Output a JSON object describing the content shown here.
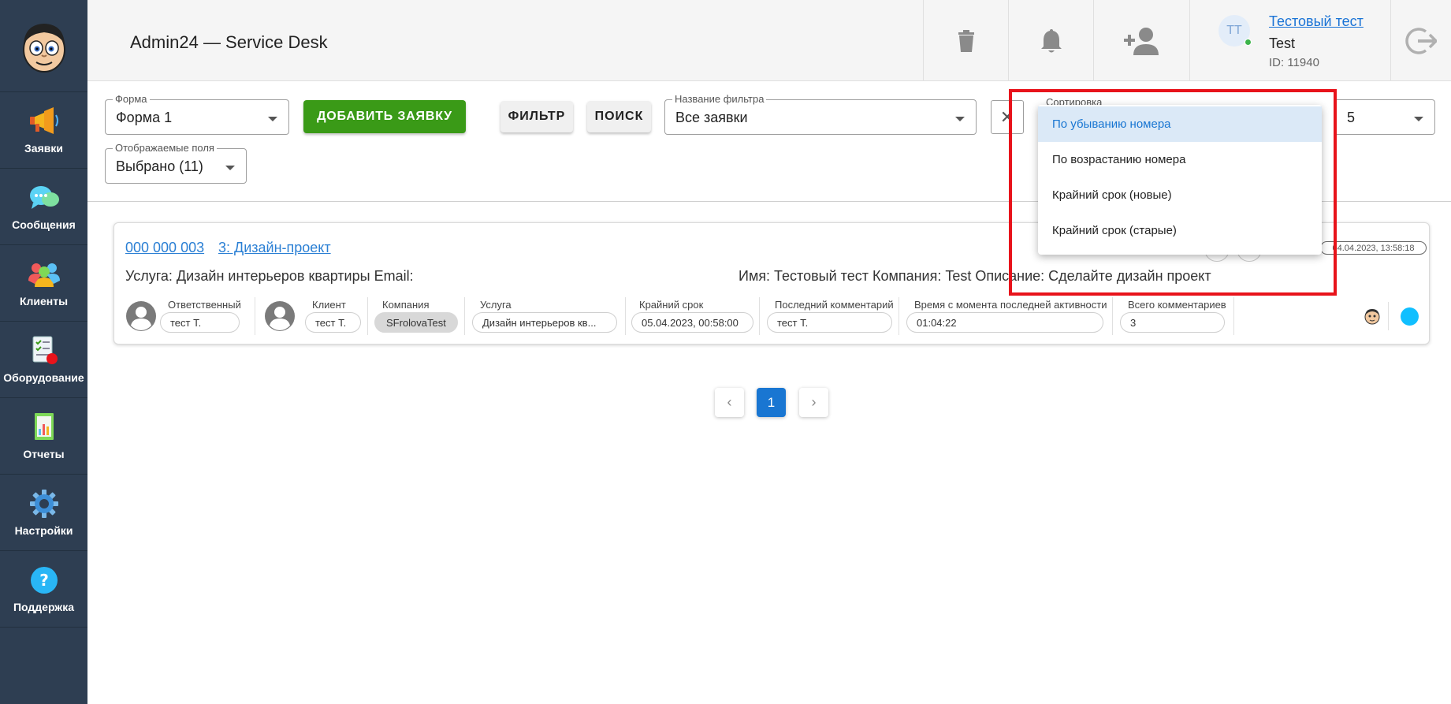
{
  "sidebar": {
    "items": [
      {
        "label": "Заявки",
        "icon": "megaphone-icon"
      },
      {
        "label": "Сообщения",
        "icon": "chat-bubbles-icon"
      },
      {
        "label": "Клиенты",
        "icon": "people-icon"
      },
      {
        "label": "Оборудование",
        "icon": "checklist-icon"
      },
      {
        "label": "Отчеты",
        "icon": "report-chart-icon"
      },
      {
        "label": "Настройки",
        "icon": "gear-icon"
      },
      {
        "label": "Поддержка",
        "icon": "help-icon"
      }
    ]
  },
  "header": {
    "title": "Admin24 — Service Desk",
    "user": {
      "initials": "TT",
      "name": "Тестовый тест",
      "login": "Test",
      "id": "ID: 11940"
    }
  },
  "toolbar": {
    "form_label": "Форма",
    "form_value": "Форма 1",
    "add_button": "ДОБАВИТЬ ЗАЯВКУ",
    "filter_button": "ФИЛЬТР",
    "search_button": "ПОИСК",
    "filter_name_label": "Название фильтра",
    "filter_name_value": "Все заявки",
    "clear_symbol": "✕",
    "sort_label": "Сортировка",
    "per_page_value": "5",
    "fields_label": "Отображаемые поля",
    "fields_value": "Выбрано (11)"
  },
  "sort_dropdown": {
    "options": [
      "По убыванию номера",
      "По возрастанию номера",
      "Крайний срок (новые)",
      "Крайний срок (старые)"
    ],
    "selected": "По убыванию номера"
  },
  "ticket": {
    "number": "000 000 003",
    "title": "3: Дизайн-проект",
    "date": "04.04.2023, 13:58:18",
    "description_left": "Услуга: Дизайн интерьеров квартиры Email:",
    "description_right": "Имя: Тестовый тест Компания: Test Описание: Сделайте дизайн проект",
    "fields": [
      {
        "label": "Ответственный",
        "value": "тест Т."
      },
      {
        "label": "Клиент",
        "value": "тест Т."
      },
      {
        "label": "Компания",
        "value": "SFrolovaTest"
      },
      {
        "label": "Услуга",
        "value": "Дизайн интерьеров кв..."
      },
      {
        "label": "Крайний срок",
        "value": "05.04.2023, 00:58:00"
      },
      {
        "label": "Последний комментарий",
        "value": "тест Т."
      },
      {
        "label": "Время с момента последней активности",
        "value": "01:04:22"
      },
      {
        "label": "Всего комментариев",
        "value": "3"
      }
    ],
    "status_color": "#10bfff"
  },
  "pagination": {
    "current": "1",
    "prev": "‹",
    "next": "›"
  },
  "colors": {
    "sidebar_bg": "#2e3e52",
    "add_button": "#3a9a17",
    "link": "#2a7fd4",
    "highlight_box": "#e8131b"
  }
}
